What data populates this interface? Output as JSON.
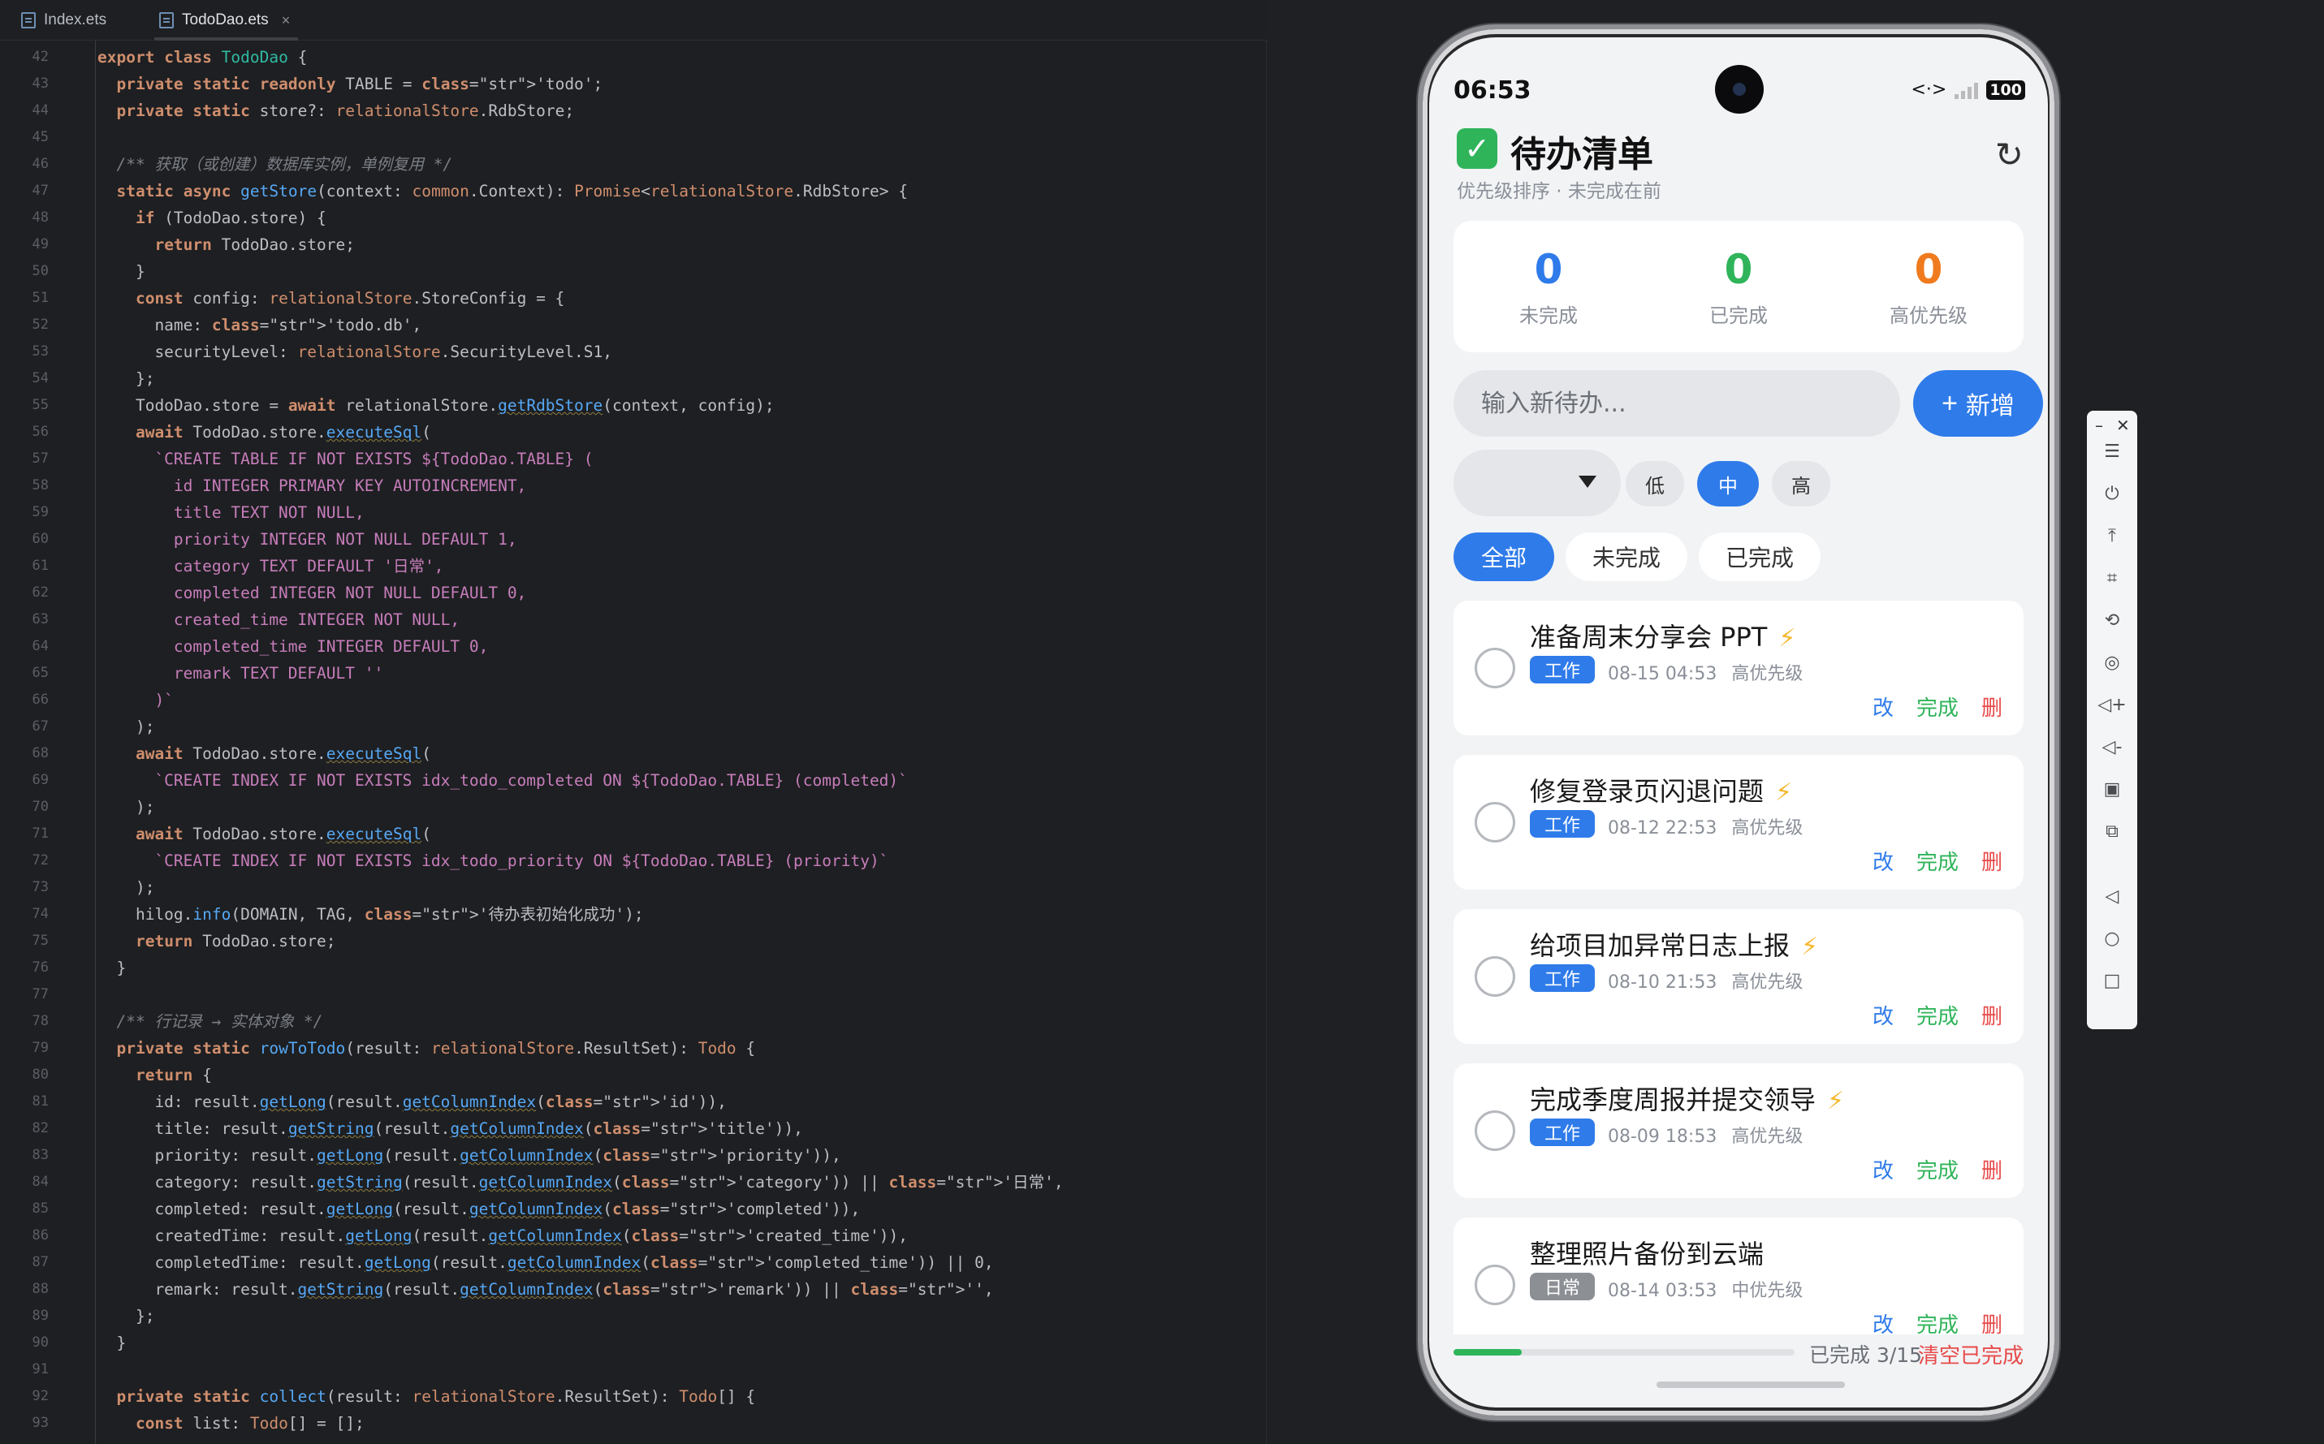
{
  "ide": {
    "tabs": [
      {
        "label": "Index.ets"
      },
      {
        "label": "TodoDao.ets",
        "active": true
      }
    ],
    "line_numbers": [
      "42",
      "43",
      "44",
      "45",
      "46",
      "47",
      "48",
      "49",
      "50",
      "51",
      "52",
      "53",
      "54",
      "55",
      "56",
      "57",
      "58",
      "59",
      "60",
      "61",
      "62",
      "63",
      "64",
      "65",
      "66",
      "67",
      "68",
      "69",
      "70",
      "71",
      "72",
      "73",
      "74",
      "75",
      "76",
      "77",
      "78",
      "79",
      "80",
      "81",
      "82",
      "83",
      "84",
      "85",
      "86",
      "87",
      "88",
      "89",
      "90",
      "91",
      "92",
      "93"
    ],
    "code_lines": [
      "export class TodoDao {",
      "  private static readonly TABLE = 'todo';",
      "  private static store?: relationalStore.RdbStore;",
      "",
      "  /** 获取（或创建）数据库实例，单例复用 */",
      "  static async getStore(context: common.Context): Promise<relationalStore.RdbStore> {",
      "    if (TodoDao.store) {",
      "      return TodoDao.store;",
      "    }",
      "    const config: relationalStore.StoreConfig = {",
      "      name: 'todo.db',",
      "      securityLevel: relationalStore.SecurityLevel.S1,",
      "    };",
      "    TodoDao.store = await relationalStore.getRdbStore(context, config);",
      "    await TodoDao.store.executeSql(",
      "      `CREATE TABLE IF NOT EXISTS ${TodoDao.TABLE} (",
      "        id INTEGER PRIMARY KEY AUTOINCREMENT,",
      "        title TEXT NOT NULL,",
      "        priority INTEGER NOT NULL DEFAULT 1,",
      "        category TEXT DEFAULT '日常',",
      "        completed INTEGER NOT NULL DEFAULT 0,",
      "        created_time INTEGER NOT NULL,",
      "        completed_time INTEGER DEFAULT 0,",
      "        remark TEXT DEFAULT ''",
      "      )`",
      "    );",
      "    await TodoDao.store.executeSql(",
      "      `CREATE INDEX IF NOT EXISTS idx_todo_completed ON ${TodoDao.TABLE} (completed)`",
      "    );",
      "    await TodoDao.store.executeSql(",
      "      `CREATE INDEX IF NOT EXISTS idx_todo_priority ON ${TodoDao.TABLE} (priority)`",
      "    );",
      "    hilog.info(DOMAIN, TAG, '待办表初始化成功');",
      "    return TodoDao.store;",
      "  }",
      "",
      "  /** 行记录 → 实体对象 */",
      "  private static rowToTodo(result: relationalStore.ResultSet): Todo {",
      "    return {",
      "      id: result.getLong(result.getColumnIndex('id')),",
      "      title: result.getString(result.getColumnIndex('title')),",
      "      priority: result.getLong(result.getColumnIndex('priority')),",
      "      category: result.getString(result.getColumnIndex('category')) || '日常',",
      "      completed: result.getLong(result.getColumnIndex('completed')),",
      "      createdTime: result.getLong(result.getColumnIndex('created_time')),",
      "      completedTime: result.getLong(result.getColumnIndex('completed_time')) || 0,",
      "      remark: result.getString(result.getColumnIndex('remark')) || '',",
      "    };",
      "  }",
      "",
      "  private static collect(result: relationalStore.ResultSet): Todo[] {",
      "    const list: Todo[] = [];"
    ]
  },
  "phone": {
    "status": {
      "time": "06:53",
      "network": "<·>",
      "battery": "100"
    },
    "header": {
      "title": "待办清单",
      "subtitle": "优先级排序 · 未完成在前",
      "refresh_icon": "refresh-icon"
    },
    "stats": [
      {
        "value": "0",
        "label": "未完成",
        "color": "#2f7bea"
      },
      {
        "value": "0",
        "label": "已完成",
        "color": "#2fb45a"
      },
      {
        "value": "0",
        "label": "高优先级",
        "color": "#f07b1e"
      }
    ],
    "input": {
      "placeholder": "输入新待办..."
    },
    "add_label": "新增",
    "priority_options": [
      "低",
      "中",
      "高"
    ],
    "priority_selected": "中",
    "filters": [
      "全部",
      "未完成",
      "已完成"
    ],
    "filter_selected": "全部",
    "todos": [
      {
        "title": "准备周末分享会 PPT",
        "bolt": "⚡",
        "tag": "工作",
        "date": "08-15 04:53",
        "level": "高优先级"
      },
      {
        "title": "修复登录页闪退问题",
        "bolt": "⚡",
        "tag": "工作",
        "date": "08-12 22:53",
        "level": "高优先级"
      },
      {
        "title": "给项目加异常日志上报",
        "bolt": "⚡",
        "tag": "工作",
        "date": "08-10 21:53",
        "level": "高优先级"
      },
      {
        "title": "完成季度周报并提交领导",
        "bolt": "⚡",
        "tag": "工作",
        "date": "08-09 18:53",
        "level": "高优先级"
      },
      {
        "title": "整理照片备份到云端",
        "bolt": "",
        "tag": "日常",
        "date": "08-14 03:53",
        "level": "中优先级"
      }
    ],
    "actions": {
      "edit": "改",
      "done": "完成",
      "delete": "删"
    },
    "progress": {
      "text": "已完成 3/15",
      "completed": 3,
      "total": 15
    },
    "clear_label": "清空已完成",
    "colors": {
      "accent": "#2f7bea",
      "success": "#2fb45a",
      "danger": "#e84a4a",
      "warning": "#f07b1e"
    }
  },
  "emulator_toolbar": {
    "controls": [
      "minimize",
      "close"
    ],
    "buttons": [
      "menu-icon",
      "power-icon",
      "scroll-top-icon",
      "crop-icon",
      "rotate-icon",
      "location-icon",
      "volume-up-icon",
      "volume-down-icon",
      "shake-icon",
      "screenshot-icon",
      "back-icon",
      "home-icon",
      "recents-icon"
    ]
  }
}
